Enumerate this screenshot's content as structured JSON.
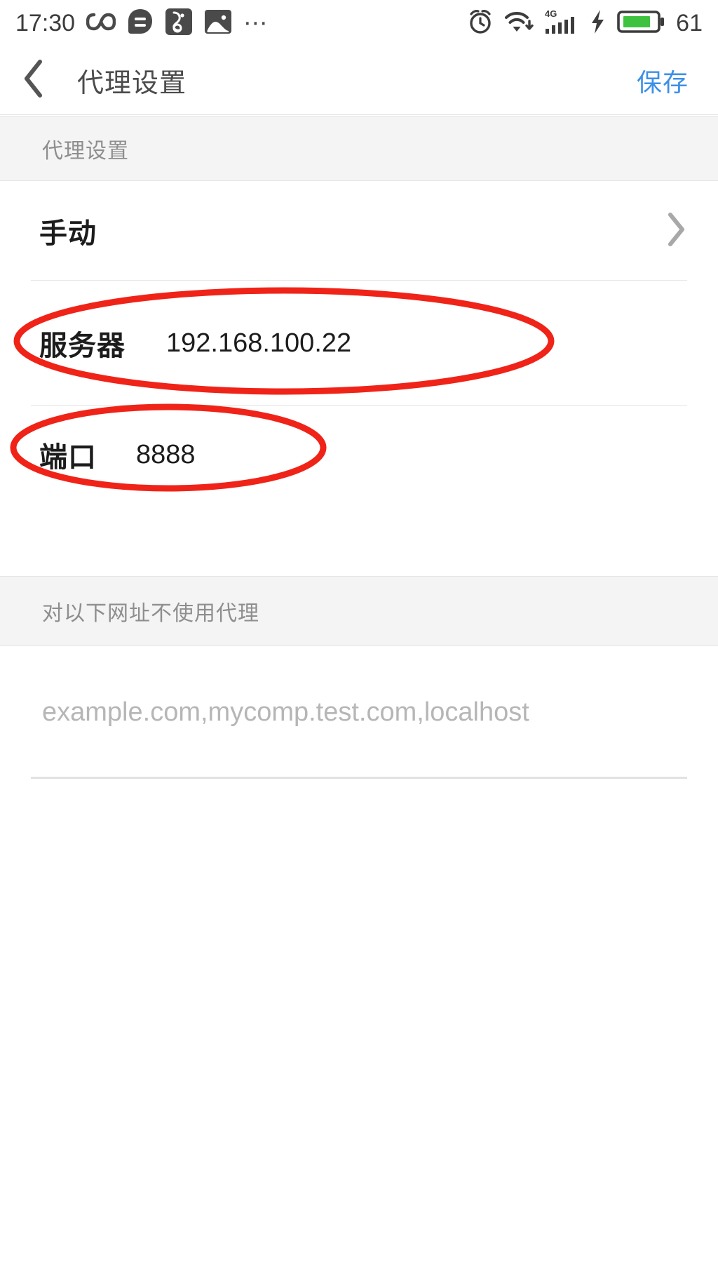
{
  "status_bar": {
    "time": "17:30",
    "battery_percent": "61",
    "left_icons": [
      "infinity-icon",
      "message-icon",
      "uc-browser-icon",
      "gallery-icon",
      "more-dots-icon"
    ],
    "right_icons": [
      "alarm-clock-icon",
      "wifi-download-icon",
      "signal-4g-icon",
      "charging-bolt-icon",
      "battery-icon"
    ],
    "network_type": "4G",
    "battery_color": "#3fc23f"
  },
  "navbar": {
    "back_icon": "chevron-left-icon",
    "title": "代理设置",
    "action_label": "保存",
    "action_color": "#3c90e8"
  },
  "sections": {
    "proxy": {
      "header": "代理设置",
      "rows": [
        {
          "label": "手动",
          "value": "",
          "accessory": "chevron-right-icon"
        },
        {
          "label": "服务器",
          "value": "192.168.100.22",
          "accessory": ""
        },
        {
          "label": "端口",
          "value": "8888",
          "accessory": ""
        }
      ]
    },
    "bypass": {
      "header": "对以下网址不使用代理",
      "placeholder": "example.com,mycomp.test.com,localhost",
      "value": ""
    }
  },
  "annotations": {
    "color": "#f02318",
    "shapes": [
      {
        "name": "server-row-highlight",
        "type": "ellipse"
      },
      {
        "name": "port-row-highlight",
        "type": "ellipse"
      }
    ]
  }
}
